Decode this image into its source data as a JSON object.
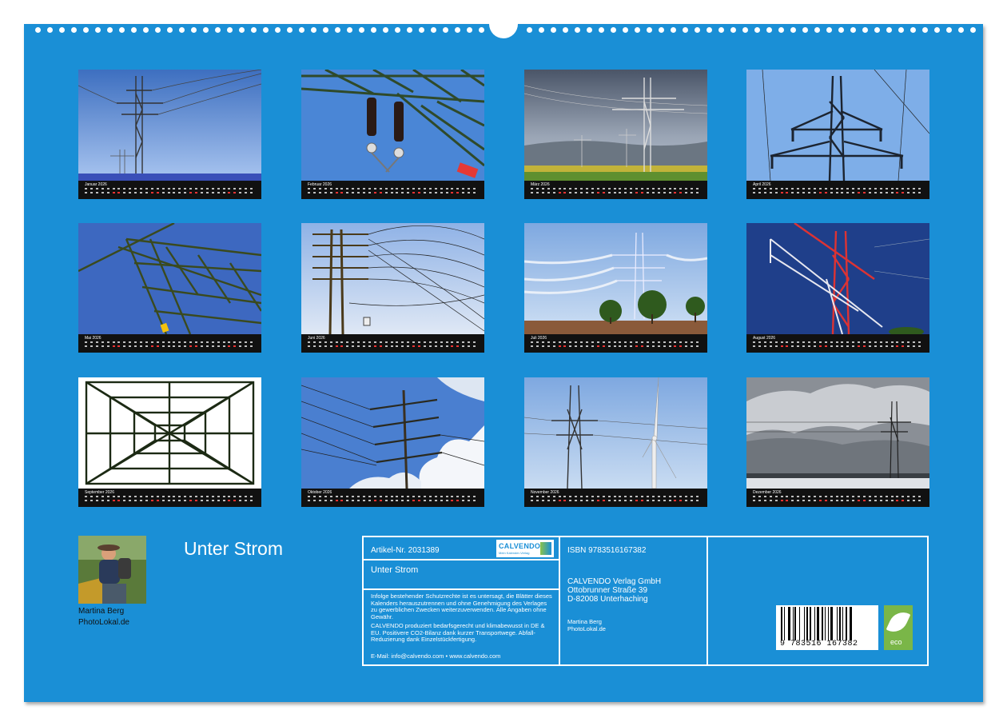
{
  "months": [
    {
      "name": "Januar 2026"
    },
    {
      "name": "Februar 2026"
    },
    {
      "name": "März 2026"
    },
    {
      "name": "April 2026"
    },
    {
      "name": "Mai 2026"
    },
    {
      "name": "Juni 2026"
    },
    {
      "name": "Juli 2026"
    },
    {
      "name": "August 2026"
    },
    {
      "name": "September 2026"
    },
    {
      "name": "Oktober 2026"
    },
    {
      "name": "November 2026"
    },
    {
      "name": "Dezember 2026"
    }
  ],
  "title": "Unter Strom",
  "author": {
    "name": "Martina Berg",
    "site": "PhotoLokal.de"
  },
  "info": {
    "article": "Artikel-Nr. 2031389",
    "logo": "CALVENDO",
    "logo_sub": "Mein Kalender-Verlag",
    "title": "Unter Strom",
    "legal": "Infolge bestehender Schutzrechte ist es untersagt, die Blätter dieses Kalenders herauszutrennen und ohne Genehmigung des Verlages zu gewerblichen Zwecken weiterzuverwenden. Alle Angaben ohne Gewähr.",
    "eco_text": "CALVENDO produziert bedarfsgerecht und klimabewusst in DE & EU. Positivere CO2-Bilanz dank kurzer Transportwege. Abfall-Reduzierung dank Einzelstückfertigung.",
    "contact": "E-Mail: info@calvendo.com • www.calvendo.com",
    "isbn": "ISBN 9783516167382",
    "publisher": [
      "CALVENDO Verlag GmbH",
      "Ottobrunner Straße 39",
      "D-82008 Unterhaching"
    ],
    "photographer": [
      "Martina Berg",
      "PhotoLokal.de"
    ],
    "barcode": "9 783516 167382",
    "eco_label": "eco"
  },
  "colors": {
    "background": "#1a8fd6",
    "strip": "#111111",
    "eco": "#7ab648"
  }
}
